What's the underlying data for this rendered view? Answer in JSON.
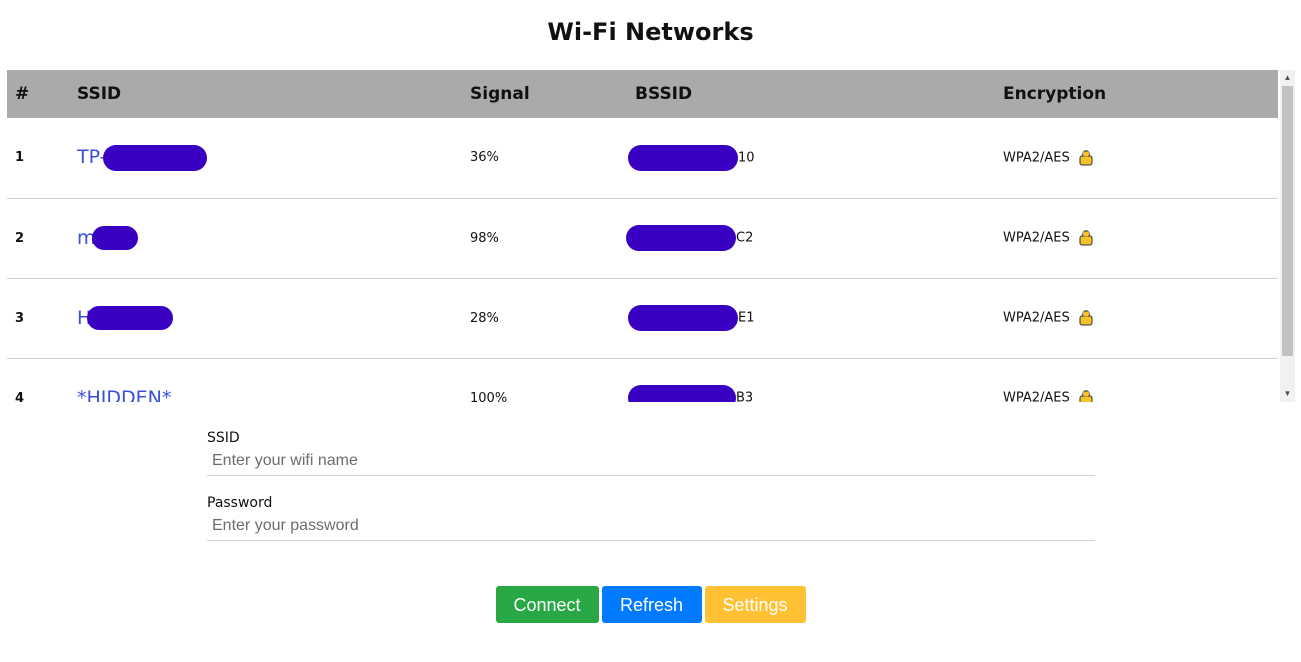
{
  "title": "Wi-Fi Networks",
  "table": {
    "headers": [
      "#",
      "SSID",
      "Signal",
      "BSSID",
      "Encryption"
    ],
    "rows": [
      {
        "num": "1",
        "ssid": "TP-",
        "signal": "36%",
        "bssid": "10",
        "encryption": "WPA2/AES"
      },
      {
        "num": "2",
        "ssid": "m",
        "signal": "98%",
        "bssid": "C2",
        "encryption": "WPA2/AES"
      },
      {
        "num": "3",
        "ssid": "H",
        "signal": "28%",
        "bssid": "E1",
        "encryption": "WPA2/AES"
      },
      {
        "num": "4",
        "ssid": "*HIDDEN*",
        "signal": "100%",
        "bssid": "B3",
        "encryption": "WPA2/AES"
      }
    ]
  },
  "form": {
    "ssid_label": "SSID",
    "ssid_placeholder": "Enter your wifi name",
    "password_label": "Password",
    "password_placeholder": "Enter your password"
  },
  "buttons": {
    "connect": "Connect",
    "refresh": "Refresh",
    "settings": "Settings"
  },
  "colors": {
    "header_bg": "#aaaaaa",
    "link": "#3a4fd8",
    "connect": "#28a745",
    "refresh": "#007bff",
    "settings": "#ffc133",
    "redaction": "#3a00c2"
  },
  "icons": {
    "encryption": "lock-icon",
    "scroll_up": "scroll-up-arrow-icon",
    "scroll_down": "scroll-down-arrow-icon"
  }
}
